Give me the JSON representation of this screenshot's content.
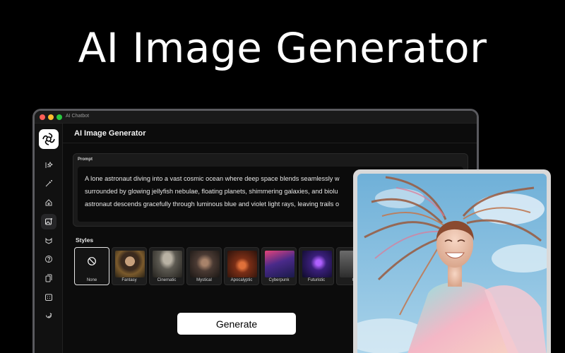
{
  "hero": {
    "title": "AI Image Generator"
  },
  "window": {
    "title": "AI Chatbot"
  },
  "header": {
    "title": "AI Image Generator"
  },
  "sidebar": {
    "items": [
      {
        "icon": "text-sparkle-icon"
      },
      {
        "icon": "magic-wand-icon"
      },
      {
        "icon": "home-icon"
      },
      {
        "icon": "image-generator-icon",
        "active": true
      },
      {
        "icon": "pixel-art-icon"
      },
      {
        "icon": "help-icon"
      },
      {
        "icon": "documents-icon"
      },
      {
        "icon": "calendar-icon"
      },
      {
        "icon": "bookmark-icon"
      }
    ]
  },
  "prompt": {
    "label": "Prompt",
    "lines": [
      "A lone astronaut diving into a vast cosmic ocean where deep space blends seamlessly w",
      "surrounded by glowing jellyfish nebulae, floating planets, shimmering galaxies, and biolu",
      "astronaut descends gracefully through luminous blue and violet light rays, leaving trails o"
    ]
  },
  "styles": {
    "label": "Styles",
    "items": [
      {
        "name": "None",
        "selected": true
      },
      {
        "name": "Fantasy"
      },
      {
        "name": "Cinematic"
      },
      {
        "name": "Mystical"
      },
      {
        "name": "Apocalyptic"
      },
      {
        "name": "Cyberpunk"
      },
      {
        "name": "Futuristic"
      },
      {
        "name": "G"
      }
    ]
  },
  "generate": {
    "label": "Generate"
  },
  "colors": {
    "accent": "#ffffff",
    "background": "#000000",
    "panel": "#1a1a1a"
  }
}
